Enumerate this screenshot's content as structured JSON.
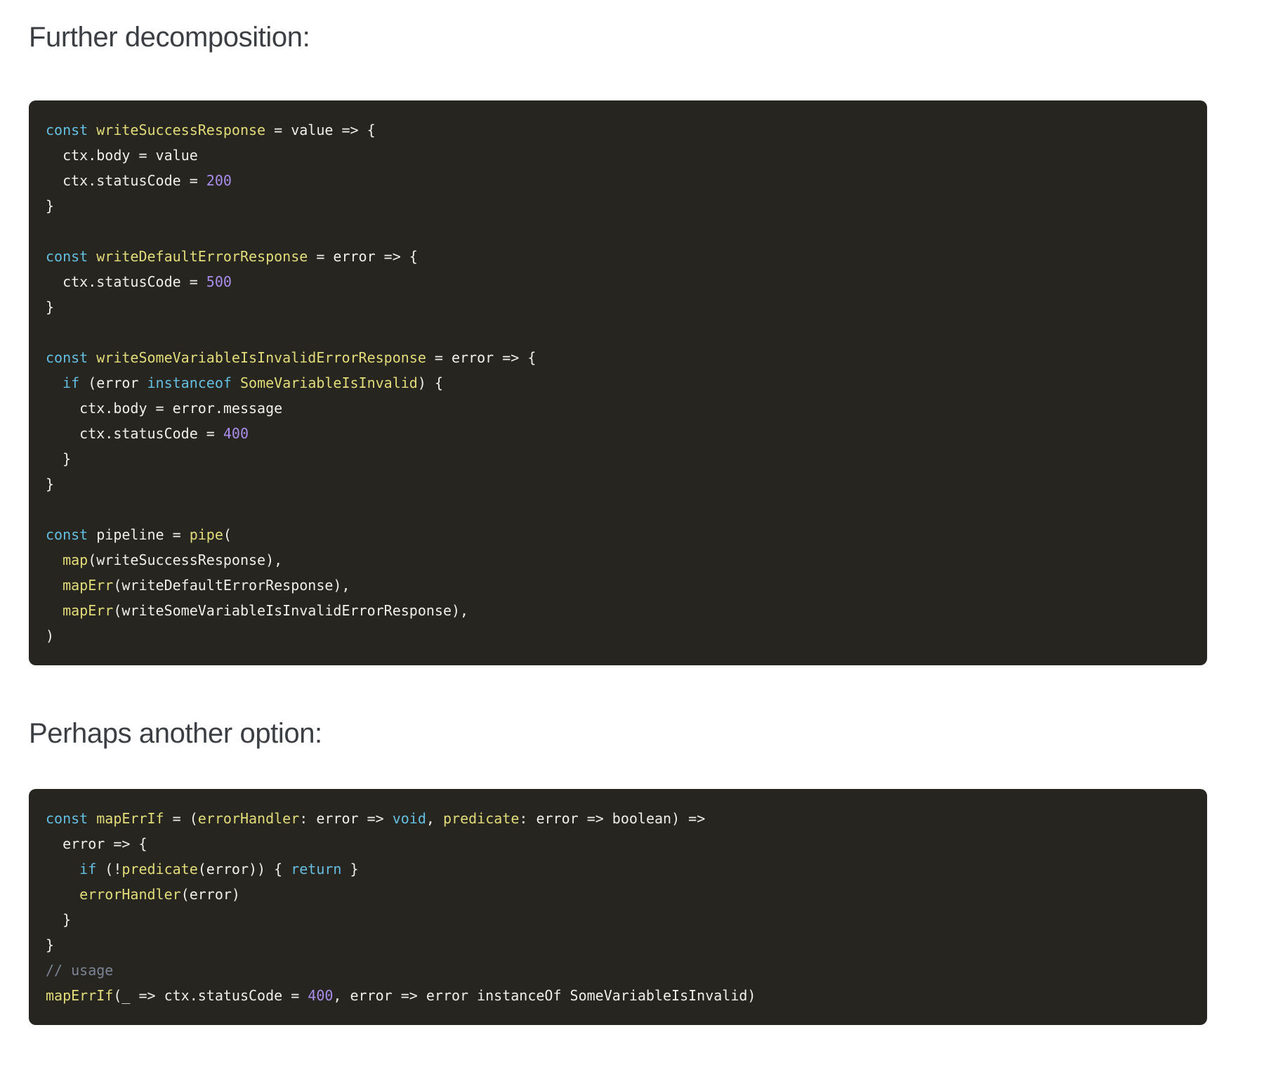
{
  "colors": {
    "page_background": "#ffffff",
    "heading": "#3b3e43",
    "code_background": "#26251f",
    "code_text": "#f0efe9",
    "keyword": "#64bfe2",
    "function_name": "#e3dc7a",
    "number": "#a98ceb",
    "comment": "#7b8495"
  },
  "sections": [
    {
      "heading": "Further decomposition:",
      "code_lines": [
        [
          {
            "c": "keyword",
            "t": "const"
          },
          {
            "c": "plain",
            "t": " "
          },
          {
            "c": "func",
            "t": "writeSuccessResponse"
          },
          {
            "c": "plain",
            "t": " = value => {"
          }
        ],
        [
          {
            "c": "plain",
            "t": "  ctx.body = value"
          }
        ],
        [
          {
            "c": "plain",
            "t": "  ctx.statusCode = "
          },
          {
            "c": "num",
            "t": "200"
          }
        ],
        [
          {
            "c": "plain",
            "t": "}"
          }
        ],
        [],
        [
          {
            "c": "keyword",
            "t": "const"
          },
          {
            "c": "plain",
            "t": " "
          },
          {
            "c": "func",
            "t": "writeDefaultErrorResponse"
          },
          {
            "c": "plain",
            "t": " = error => {"
          }
        ],
        [
          {
            "c": "plain",
            "t": "  ctx.statusCode = "
          },
          {
            "c": "num",
            "t": "500"
          }
        ],
        [
          {
            "c": "plain",
            "t": "}"
          }
        ],
        [],
        [
          {
            "c": "keyword",
            "t": "const"
          },
          {
            "c": "plain",
            "t": " "
          },
          {
            "c": "func",
            "t": "writeSomeVariableIsInvalidErrorResponse"
          },
          {
            "c": "plain",
            "t": " = error => {"
          }
        ],
        [
          {
            "c": "plain",
            "t": "  "
          },
          {
            "c": "keyword",
            "t": "if"
          },
          {
            "c": "plain",
            "t": " (error "
          },
          {
            "c": "keyword",
            "t": "instanceof"
          },
          {
            "c": "plain",
            "t": " "
          },
          {
            "c": "func",
            "t": "SomeVariableIsInvalid"
          },
          {
            "c": "plain",
            "t": ") {"
          }
        ],
        [
          {
            "c": "plain",
            "t": "    ctx.body = error.message"
          }
        ],
        [
          {
            "c": "plain",
            "t": "    ctx.statusCode = "
          },
          {
            "c": "num",
            "t": "400"
          }
        ],
        [
          {
            "c": "plain",
            "t": "  }"
          }
        ],
        [
          {
            "c": "plain",
            "t": "}"
          }
        ],
        [],
        [
          {
            "c": "keyword",
            "t": "const"
          },
          {
            "c": "plain",
            "t": " pipeline = "
          },
          {
            "c": "func",
            "t": "pipe"
          },
          {
            "c": "plain",
            "t": "("
          }
        ],
        [
          {
            "c": "plain",
            "t": "  "
          },
          {
            "c": "func",
            "t": "map"
          },
          {
            "c": "plain",
            "t": "(writeSuccessResponse),"
          }
        ],
        [
          {
            "c": "plain",
            "t": "  "
          },
          {
            "c": "func",
            "t": "mapErr"
          },
          {
            "c": "plain",
            "t": "(writeDefaultErrorResponse),"
          }
        ],
        [
          {
            "c": "plain",
            "t": "  "
          },
          {
            "c": "func",
            "t": "mapErr"
          },
          {
            "c": "plain",
            "t": "(writeSomeVariableIsInvalidErrorResponse),"
          }
        ],
        [
          {
            "c": "plain",
            "t": ")"
          }
        ]
      ]
    },
    {
      "heading": "Perhaps another option:",
      "code_lines": [
        [
          {
            "c": "keyword",
            "t": "const"
          },
          {
            "c": "plain",
            "t": " "
          },
          {
            "c": "func",
            "t": "mapErrIf"
          },
          {
            "c": "plain",
            "t": " = ("
          },
          {
            "c": "func",
            "t": "errorHandler"
          },
          {
            "c": "plain",
            "t": ": error => "
          },
          {
            "c": "keyword",
            "t": "void"
          },
          {
            "c": "plain",
            "t": ", "
          },
          {
            "c": "func",
            "t": "predicate"
          },
          {
            "c": "plain",
            "t": ": error => boolean) =>"
          }
        ],
        [
          {
            "c": "plain",
            "t": "  error => {"
          }
        ],
        [
          {
            "c": "plain",
            "t": "    "
          },
          {
            "c": "keyword",
            "t": "if"
          },
          {
            "c": "plain",
            "t": " (!"
          },
          {
            "c": "func",
            "t": "predicate"
          },
          {
            "c": "plain",
            "t": "(error)) { "
          },
          {
            "c": "keyword",
            "t": "return"
          },
          {
            "c": "plain",
            "t": " }"
          }
        ],
        [
          {
            "c": "plain",
            "t": "    "
          },
          {
            "c": "func",
            "t": "errorHandler"
          },
          {
            "c": "plain",
            "t": "(error)"
          }
        ],
        [
          {
            "c": "plain",
            "t": "  }"
          }
        ],
        [
          {
            "c": "plain",
            "t": "}"
          }
        ],
        [
          {
            "c": "comment",
            "t": "// usage"
          }
        ],
        [
          {
            "c": "func",
            "t": "mapErrIf"
          },
          {
            "c": "plain",
            "t": "(_ => ctx.statusCode = "
          },
          {
            "c": "num",
            "t": "400"
          },
          {
            "c": "plain",
            "t": ", error => error instanceOf SomeVariableIsInvalid)"
          }
        ]
      ]
    }
  ]
}
